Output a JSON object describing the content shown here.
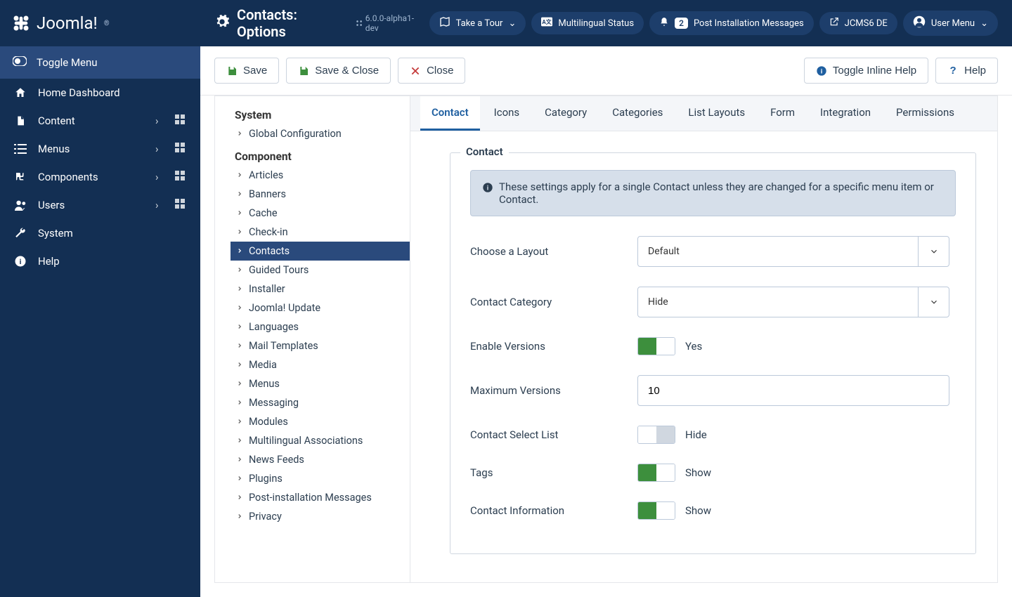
{
  "brand": "Joomla!",
  "pageTitle": "Contacts: Options",
  "version": "6.0.0-alpha1-dev",
  "topbar": {
    "tour": "Take a Tour",
    "multilingual": "Multilingual Status",
    "postInstall": "Post Installation Messages",
    "postInstallCount": "2",
    "site": "JCMS6 DE",
    "userMenu": "User Menu"
  },
  "sidebar": {
    "toggle": "Toggle Menu",
    "items": [
      {
        "label": "Home Dashboard"
      },
      {
        "label": "Content"
      },
      {
        "label": "Menus"
      },
      {
        "label": "Components"
      },
      {
        "label": "Users"
      },
      {
        "label": "System"
      },
      {
        "label": "Help"
      }
    ]
  },
  "toolbar": {
    "save": "Save",
    "saveClose": "Save & Close",
    "close": "Close",
    "toggleHelp": "Toggle Inline Help",
    "help": "Help"
  },
  "configTree": {
    "systemHeading": "System",
    "systemItems": [
      "Global Configuration"
    ],
    "componentHeading": "Component",
    "componentItems": [
      "Articles",
      "Banners",
      "Cache",
      "Check-in",
      "Contacts",
      "Guided Tours",
      "Installer",
      "Joomla! Update",
      "Languages",
      "Mail Templates",
      "Media",
      "Menus",
      "Messaging",
      "Modules",
      "Multilingual Associations",
      "News Feeds",
      "Plugins",
      "Post-installation Messages",
      "Privacy"
    ],
    "activeItem": "Contacts"
  },
  "tabs": [
    "Contact",
    "Icons",
    "Category",
    "Categories",
    "List Layouts",
    "Form",
    "Integration",
    "Permissions"
  ],
  "activeTab": "Contact",
  "fieldsetLegend": "Contact",
  "alertText": "These settings apply for a single Contact unless they are changed for a specific menu item or Contact.",
  "fields": {
    "layout": {
      "label": "Choose a Layout",
      "value": "Default"
    },
    "category": {
      "label": "Contact Category",
      "value": "Hide"
    },
    "enableVersions": {
      "label": "Enable Versions",
      "value": "Yes",
      "on": true
    },
    "maxVersions": {
      "label": "Maximum Versions",
      "value": "10"
    },
    "selectList": {
      "label": "Contact Select List",
      "value": "Hide",
      "on": false
    },
    "tags": {
      "label": "Tags",
      "value": "Show",
      "on": true
    },
    "contactInfo": {
      "label": "Contact Information",
      "value": "Show",
      "on": true
    }
  }
}
